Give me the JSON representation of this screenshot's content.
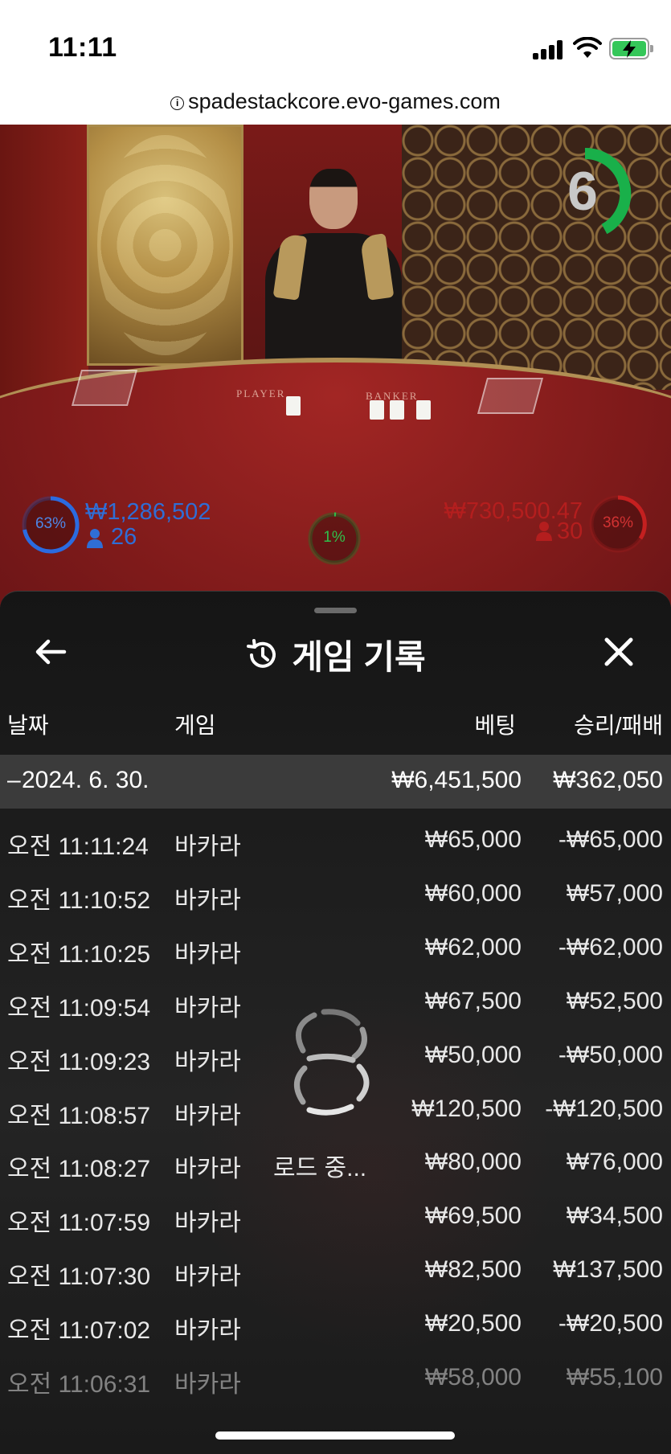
{
  "status_bar": {
    "time": "11:11"
  },
  "browser": {
    "url": "spadestackcore.evo-games.com"
  },
  "game_video": {
    "countdown": "6",
    "table_labels": [
      "PLAYER",
      "BANKER"
    ],
    "player_bet": {
      "percent": "63%",
      "amount": "₩1,286,502",
      "players": "26"
    },
    "banker_bet": {
      "percent": "36%",
      "amount": "₩730,500.47",
      "players": "30"
    },
    "tie_bet": {
      "percent": "1%"
    },
    "colors": {
      "player": "#1d4fae",
      "banker": "#b41f1f",
      "tie": "#1e9b35"
    }
  },
  "history": {
    "title": "게임 기록",
    "columns": {
      "date": "날짜",
      "game": "게임",
      "bet": "베팅",
      "winloss": "승리/패배"
    },
    "day": {
      "date": "2024. 6. 30.",
      "total_bet": "₩6,451,500",
      "total_winloss": "₩362,050"
    },
    "rows": [
      {
        "time": "오전 11:11:24",
        "game": "바카라",
        "bet": "₩65,000",
        "winloss": "-₩65,000"
      },
      {
        "time": "오전 11:10:52",
        "game": "바카라",
        "bet": "₩60,000",
        "winloss": "₩57,000"
      },
      {
        "time": "오전 11:10:25",
        "game": "바카라",
        "bet": "₩62,000",
        "winloss": "-₩62,000"
      },
      {
        "time": "오전 11:09:54",
        "game": "바카라",
        "bet": "₩67,500",
        "winloss": "₩52,500"
      },
      {
        "time": "오전 11:09:23",
        "game": "바카라",
        "bet": "₩50,000",
        "winloss": "-₩50,000"
      },
      {
        "time": "오전 11:08:57",
        "game": "바카라",
        "bet": "₩120,500",
        "winloss": "-₩120,500"
      },
      {
        "time": "오전 11:08:27",
        "game": "바카라",
        "bet": "₩80,000",
        "winloss": "₩76,000"
      },
      {
        "time": "오전 11:07:59",
        "game": "바카라",
        "bet": "₩69,500",
        "winloss": "₩34,500"
      },
      {
        "time": "오전 11:07:30",
        "game": "바카라",
        "bet": "₩82,500",
        "winloss": "₩137,500"
      },
      {
        "time": "오전 11:07:02",
        "game": "바카라",
        "bet": "₩20,500",
        "winloss": "-₩20,500"
      },
      {
        "time": "오전 11:06:31",
        "game": "바카라",
        "bet": "₩58,000",
        "winloss": "₩55,100"
      }
    ],
    "loading_text": "로드 중..."
  },
  "icons": [
    "signal-icon",
    "wifi-icon",
    "battery-charging-icon",
    "info-icon",
    "back-arrow-icon",
    "history-icon",
    "close-icon",
    "loading-spinner-icon",
    "user-icon"
  ]
}
